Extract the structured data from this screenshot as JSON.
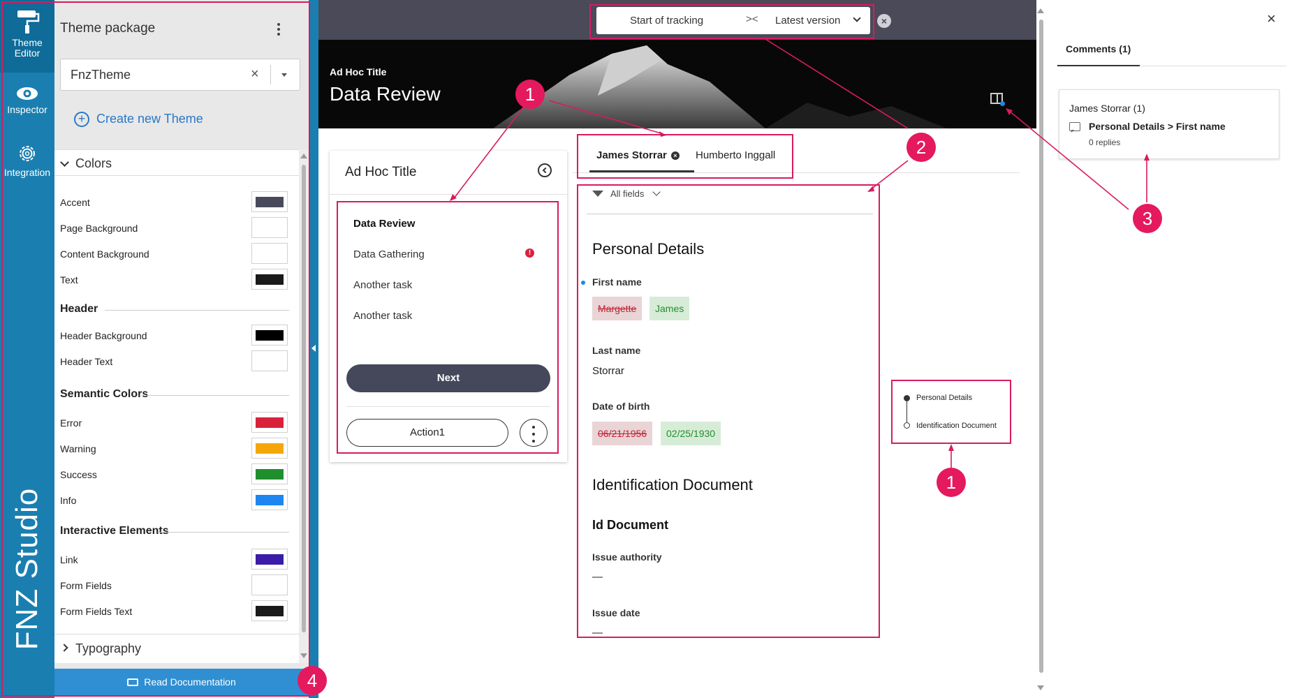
{
  "rail": {
    "theme_editor": "Theme Editor",
    "inspector": "Inspector",
    "integration": "Integration",
    "brand": "FNZ Studio"
  },
  "panel": {
    "title": "Theme package",
    "theme_value": "FnzTheme",
    "create_label": "Create new Theme",
    "colors_header": "Colors",
    "colors": [
      {
        "name": "Accent",
        "color": "#484a5c"
      },
      {
        "name": "Page Background",
        "color": "#ffffff"
      },
      {
        "name": "Content Background",
        "color": "#ffffff"
      },
      {
        "name": "Text",
        "color": "#1a1a1a"
      }
    ],
    "header_group": "Header",
    "header_colors": [
      {
        "name": "Header Background",
        "color": "#000000"
      },
      {
        "name": "Header Text",
        "color": "#ffffff"
      }
    ],
    "semantic_group": "Semantic Colors",
    "semantic_colors": [
      {
        "name": "Error",
        "color": "#d9223a"
      },
      {
        "name": "Warning",
        "color": "#f5a70a"
      },
      {
        "name": "Success",
        "color": "#1f8f2e"
      },
      {
        "name": "Info",
        "color": "#1e86f0"
      }
    ],
    "interactive_group": "Interactive Elements",
    "interactive_colors": [
      {
        "name": "Link",
        "color": "#3a1ca8"
      },
      {
        "name": "Form Fields",
        "color": "#ffffff"
      },
      {
        "name": "Form Fields Text",
        "color": "#1a1a1a"
      }
    ],
    "typography_label": "Typography",
    "docs_label": "Read Documentation"
  },
  "tracking": {
    "start": "Start of tracking",
    "latest": "Latest version"
  },
  "hero": {
    "subtitle": "Ad Hoc Title",
    "title": "Data Review"
  },
  "card": {
    "title": "Ad Hoc Title",
    "tasks": [
      "Data Review",
      "Data Gathering",
      "Another task",
      "Another task"
    ],
    "next_label": "Next",
    "action_label": "Action1"
  },
  "tabs": [
    "James Storrar",
    "Humberto Inggall"
  ],
  "form": {
    "filter_label": "All fields",
    "section1": "Personal Details",
    "first_name_label": "First name",
    "first_name_old": "Margette",
    "first_name_new": "James",
    "last_name_label": "Last name",
    "last_name_value": "Storrar",
    "dob_label": "Date of birth",
    "dob_old": "06/21/1956",
    "dob_new": "02/25/1930",
    "section2": "Identification Document",
    "subsection": "Id Document",
    "issue_authority_label": "Issue authority",
    "issue_authority_value": "—",
    "issue_date_label": "Issue date",
    "issue_date_value": "—"
  },
  "section_nav": [
    "Personal Details",
    "Identification Document"
  ],
  "comments": {
    "tab_label": "Comments (1)",
    "user": "James Storrar (1)",
    "path": "Personal Details > First name",
    "replies": "0 replies"
  },
  "annotations": {
    "badge1": "1",
    "badge2": "2",
    "badge3": "3",
    "badge4": "4",
    "color": "#d81b60"
  }
}
